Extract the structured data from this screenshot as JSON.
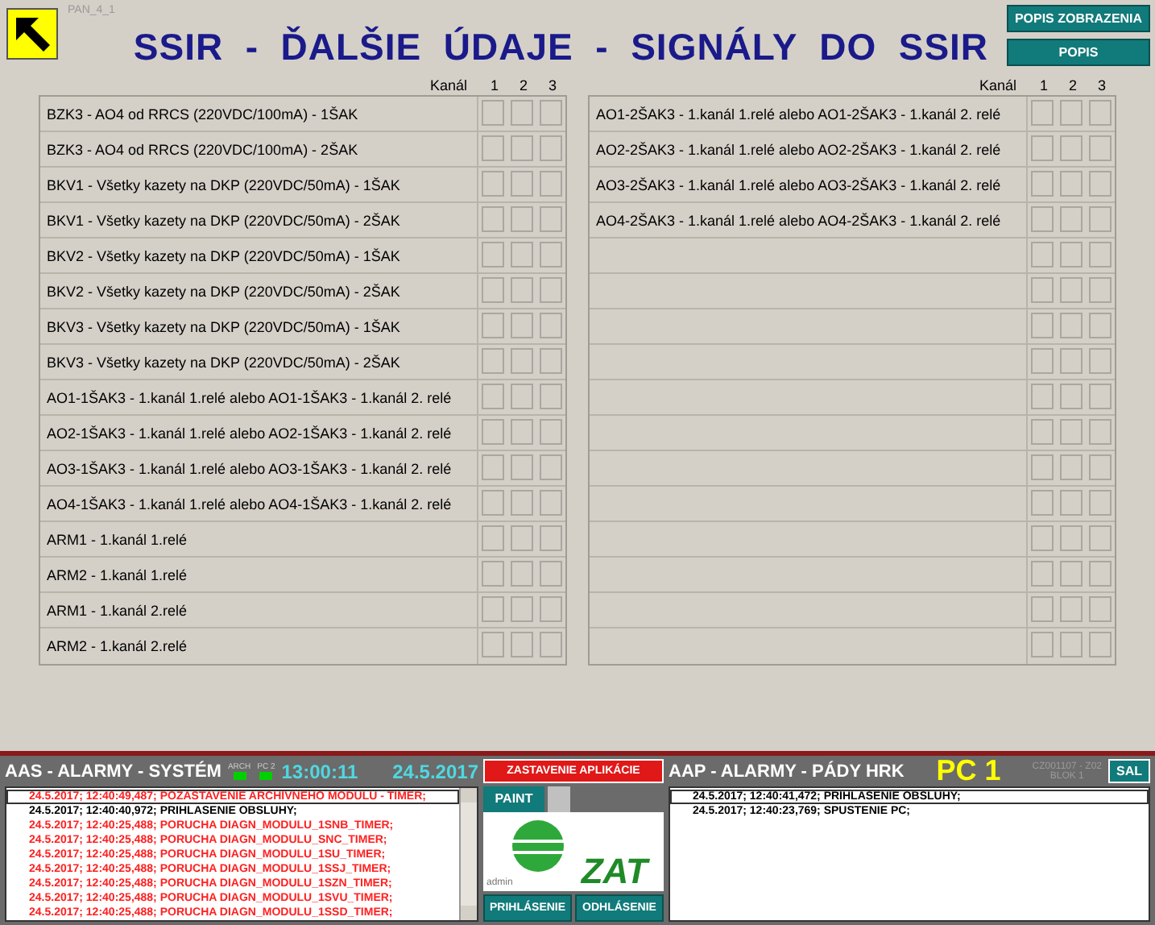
{
  "panel_id": "PAN_4_1",
  "title": "SSIR  -  ĎALŠIE  ÚDAJE  -  SIGNÁLY  DO  SSIR",
  "top_buttons": [
    "POPIS ZOBRAZENIA",
    "POPIS"
  ],
  "tables": [
    {
      "header": "Kanál",
      "channels": [
        "1",
        "2",
        "3"
      ],
      "rows": [
        "BZK3 - AO4 od RRCS (220VDC/100mA) - 1ŠAK",
        "BZK3 - AO4 od RRCS (220VDC/100mA) - 2ŠAK",
        "BKV1 - Všetky kazety na DKP (220VDC/50mA) - 1ŠAK",
        "BKV1 - Všetky kazety na DKP (220VDC/50mA) - 2ŠAK",
        "BKV2 - Všetky kazety na DKP (220VDC/50mA) - 1ŠAK",
        "BKV2 - Všetky kazety na DKP (220VDC/50mA) - 2ŠAK",
        "BKV3 - Všetky kazety na DKP (220VDC/50mA) - 1ŠAK",
        "BKV3 - Všetky kazety na DKP (220VDC/50mA) - 2ŠAK",
        "AO1-1ŠAK3 - 1.kanál 1.relé alebo AO1-1ŠAK3 - 1.kanál 2. relé",
        "AO2-1ŠAK3 - 1.kanál 1.relé alebo AO2-1ŠAK3 - 1.kanál 2. relé",
        "AO3-1ŠAK3 - 1.kanál 1.relé alebo AO3-1ŠAK3 - 1.kanál 2. relé",
        "AO4-1ŠAK3 - 1.kanál 1.relé alebo AO4-1ŠAK3 - 1.kanál 2. relé",
        "ARM1 - 1.kanál 1.relé",
        "ARM2 - 1.kanál 1.relé",
        "ARM1 - 1.kanál 2.relé",
        "ARM2 - 1.kanál 2.relé"
      ]
    },
    {
      "header": "Kanál",
      "channels": [
        "1",
        "2",
        "3"
      ],
      "rows": [
        "AO1-2ŠAK3 - 1.kanál 1.relé alebo AO1-2ŠAK3 - 1.kanál 2. relé",
        "AO2-2ŠAK3 - 1.kanál 1.relé alebo AO2-2ŠAK3 - 1.kanál 2. relé",
        "AO3-2ŠAK3 - 1.kanál 1.relé alebo AO3-2ŠAK3 - 1.kanál 2. relé",
        "AO4-2ŠAK3 - 1.kanál 1.relé alebo AO4-2ŠAK3 - 1.kanál 2. relé"
      ]
    }
  ],
  "system_alarms": {
    "title": "AAS - ALARMY - SYSTÉM",
    "indicators": [
      "ARCH",
      "PC 2"
    ],
    "time": "13:00:11",
    "date": "24.5.2017",
    "entries": [
      {
        "text": "24.5.2017; 12:40:49,487; POZASTAVENIE ARCHIVNEHO MODULU - TIMER;",
        "color": "#ff2020",
        "selected": true
      },
      {
        "text": "24.5.2017; 12:40:40,972; PRIHLASENIE OBSLUHY;",
        "color": "#000000",
        "selected": false
      },
      {
        "text": "24.5.2017; 12:40:25,488; PORUCHA DIAGN_MODULU_1SNB_TIMER;",
        "color": "#ff2020",
        "selected": false
      },
      {
        "text": "24.5.2017; 12:40:25,488; PORUCHA DIAGN_MODULU_SNC_TIMER;",
        "color": "#ff2020",
        "selected": false
      },
      {
        "text": "24.5.2017; 12:40:25,488; PORUCHA DIAGN_MODULU_1SU_TIMER;",
        "color": "#ff2020",
        "selected": false
      },
      {
        "text": "24.5.2017; 12:40:25,488; PORUCHA DIAGN_MODULU_1SSJ_TIMER;",
        "color": "#ff2020",
        "selected": false
      },
      {
        "text": "24.5.2017; 12:40:25,488; PORUCHA DIAGN_MODULU_1SZN_TIMER;",
        "color": "#ff2020",
        "selected": false
      },
      {
        "text": "24.5.2017; 12:40:25,488; PORUCHA DIAGN_MODULU_1SVU_TIMER;",
        "color": "#ff2020",
        "selected": false
      },
      {
        "text": "24.5.2017; 12:40:25,488; PORUCHA DIAGN_MODULU_1SSD_TIMER;",
        "color": "#ff2020",
        "selected": false
      }
    ]
  },
  "control": {
    "stop_button": "ZASTAVENIE APLIKÁCIE",
    "paint_button": "PAINT",
    "user": "admin",
    "logo_text": "ZAT",
    "login_button": "PRIHLÁSENIE",
    "logout_button": "ODHLÁSENIE"
  },
  "fall_alarms": {
    "title": "AAP - ALARMY - PÁDY  HRK",
    "pc": "PC 1",
    "station": "CZ001107 - Z02",
    "block": "BLOK 1",
    "sal_button": "SAL",
    "entries": [
      {
        "text": "24.5.2017; 12:40:41,472; PRIHLASENIE OBSLUHY;",
        "color": "#000000",
        "selected": true
      },
      {
        "text": "24.5.2017; 12:40:23,769; SPUSTENIE PC;",
        "color": "#000000",
        "selected": false
      }
    ]
  }
}
